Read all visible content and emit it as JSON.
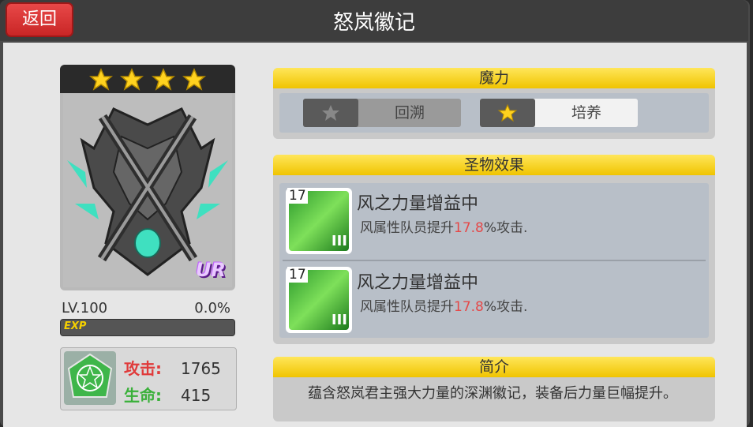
{
  "header": {
    "title": "怒岚徽记",
    "back_label": "返回"
  },
  "item": {
    "stars": 4,
    "rarity": "UR",
    "level": "LV.100",
    "exp_percent": "0.0%",
    "exp_label": "EXP",
    "attack_label": "攻击:",
    "attack_value": "1765",
    "hp_label": "生命:",
    "hp_value": "415"
  },
  "magic": {
    "title": "魔力",
    "rewind_label": "回溯",
    "cultivate_label": "培养"
  },
  "effects": {
    "title": "圣物效果",
    "list": [
      {
        "level": "17",
        "name": "风之力量增益中",
        "desc_prefix": "风属性队员提升",
        "desc_value": "17.8",
        "desc_suffix": "%攻击.",
        "tier": "III"
      },
      {
        "level": "17",
        "name": "风之力量增益中",
        "desc_prefix": "风属性队员提升",
        "desc_value": "17.8",
        "desc_suffix": "%攻击.",
        "tier": "III"
      }
    ]
  },
  "intro": {
    "title": "简介",
    "text": "蕴含怒岚君主强大力量的深渊徽记，装备后力量巨幅提升。"
  },
  "colors": {
    "accent_yellow": "#f0c400",
    "back_red": "#d93030",
    "highlight": "#e54848",
    "attack": "#e03a3a",
    "hp": "#3ab03a"
  }
}
